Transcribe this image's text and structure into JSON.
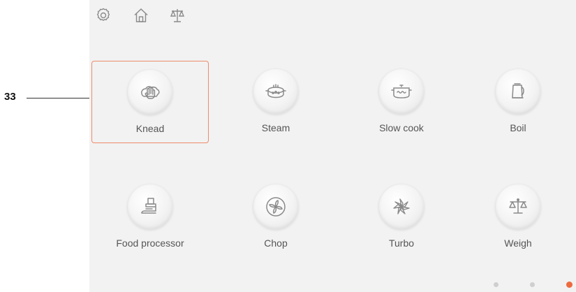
{
  "callout": {
    "number": "33"
  },
  "topbar": {
    "icons": [
      "settings-icon",
      "home-icon",
      "scale-icon"
    ]
  },
  "programs": [
    {
      "label": "Knead",
      "icon": "hand-icon",
      "selected": true
    },
    {
      "label": "Steam",
      "icon": "steam-pot-icon",
      "selected": false
    },
    {
      "label": "Slow cook",
      "icon": "slow-cook-pot-icon",
      "selected": false
    },
    {
      "label": "Boil",
      "icon": "kettle-icon",
      "selected": false
    },
    {
      "label": "Food processor",
      "icon": "food-processor-icon",
      "selected": false
    },
    {
      "label": "Chop",
      "icon": "chop-blade-icon",
      "selected": false
    },
    {
      "label": "Turbo",
      "icon": "turbo-icon",
      "selected": false
    },
    {
      "label": "Weigh",
      "icon": "scale-icon",
      "selected": false
    }
  ],
  "pagination": {
    "pages": 3,
    "current": 3
  },
  "colors": {
    "accent": "#ee6a3f",
    "selected_border": "#ef8b6a",
    "icon_stroke": "#8a8a8a",
    "background": "#f2f2f2"
  }
}
